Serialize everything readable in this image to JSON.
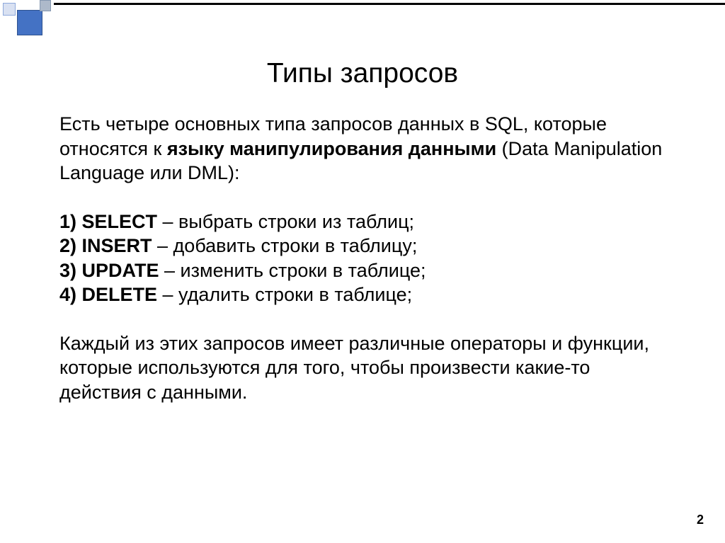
{
  "title": "Типы запросов",
  "intro": {
    "part1": "Есть четыре основных типа запросов данных в SQL, которые относятся к ",
    "bold": "языку манипулирования данными",
    "part2": " (Data Manipulation Language или DML):"
  },
  "items": [
    {
      "num": "1) ",
      "cmd": "SELECT",
      "desc": " – выбрать строки из таблиц;"
    },
    {
      "num": "2) ",
      "cmd": "INSERT",
      "desc": " – добавить строки в таблицу;"
    },
    {
      "num": "3) ",
      "cmd": "UPDATE",
      "desc": " – изменить строки в таблице;"
    },
    {
      "num": "4) ",
      "cmd": "DELETE",
      "desc": " – удалить строки в таблице;"
    }
  ],
  "outro": "Каждый из этих запросов имеет различные операторы и функции, которые используются для того, чтобы произвести какие-то действия с данными.",
  "page_number": "2"
}
